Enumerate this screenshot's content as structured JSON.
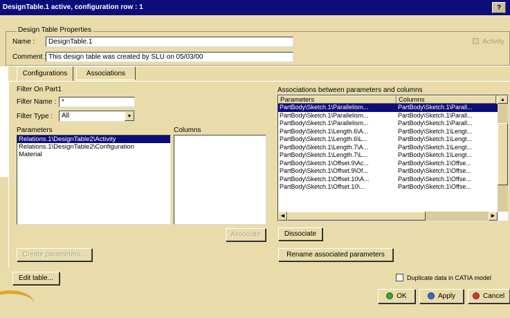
{
  "window": {
    "title": "DesignTable.1 active, configuration row : 1",
    "help_label": "?"
  },
  "properties": {
    "group_title": "Design Table Properties",
    "name_label": "Name :",
    "name_value": "DesignTable.1",
    "comment_label": "Comment :",
    "comment_value": "This design table was created by SLU on 05/03/00",
    "activity_label": "Activity"
  },
  "tabs": [
    {
      "label": "Configurations"
    },
    {
      "label": "Associations"
    }
  ],
  "filter": {
    "title": "Filter On Part1",
    "name_label": "Filter Name :",
    "name_value": "*",
    "type_label": "Filter Type :",
    "type_value": "All"
  },
  "parameters": {
    "label": "Parameters",
    "items": [
      "Relations.1\\DesignTable2\\Activity",
      "Relations.1\\DesignTable2\\Configuration",
      "Material"
    ]
  },
  "columns": {
    "label": "Columns",
    "items": []
  },
  "associations": {
    "label": "Associations between parameters and columns",
    "headers": [
      "Parameters",
      "Columns"
    ],
    "rows": [
      [
        "PartBody\\Sketch.1\\Parallelism...",
        "PartBody\\Sketch.1\\Parall..."
      ],
      [
        "PartBody\\Sketch.1\\Parallelism...",
        "PartBody\\Sketch.1\\Parall..."
      ],
      [
        "PartBody\\Sketch.1\\Parallelism...",
        "PartBody\\Sketch.1\\Parall..."
      ],
      [
        "PartBody\\Sketch.1\\Length.6\\A...",
        "PartBody\\Sketch.1\\Lengt..."
      ],
      [
        "PartBody\\Sketch.1\\Length.6\\L...",
        "PartBody\\Sketch.1\\Lengt..."
      ],
      [
        "PartBody\\Sketch.1\\Length.7\\A...",
        "PartBody\\Sketch.1\\Lengt..."
      ],
      [
        "PartBody\\Sketch.1\\Length.7\\L...",
        "PartBody\\Sketch.1\\Lengt..."
      ],
      [
        "PartBody\\Sketch.1\\Offset.9\\Ac...",
        "PartBody\\Sketch.1\\Offse..."
      ],
      [
        "PartBody\\Sketch.1\\Offset.9\\Of...",
        "PartBody\\Sketch.1\\Offse..."
      ],
      [
        "PartBody\\Sketch.1\\Offset.10\\A...",
        "PartBody\\Sketch.1\\Offse..."
      ],
      [
        "PartBody\\Sketch.1\\Offset.10\\...",
        "PartBody\\Sketch.1\\Offse..."
      ]
    ]
  },
  "buttons": {
    "associate": "Associate",
    "dissociate": "Dissociate",
    "create_parameters": "Create parameters...",
    "rename": "Rename associated parameters",
    "edit_table": "Edit table...",
    "duplicate_label": "Duplicate data in CATIA model",
    "ok": "OK",
    "apply": "Apply",
    "cancel": "Cancel"
  },
  "colors": {
    "dialog_bg": "#e9dcaa",
    "title_bar": "#0d0d7a",
    "selection": "#0d0d7a"
  }
}
